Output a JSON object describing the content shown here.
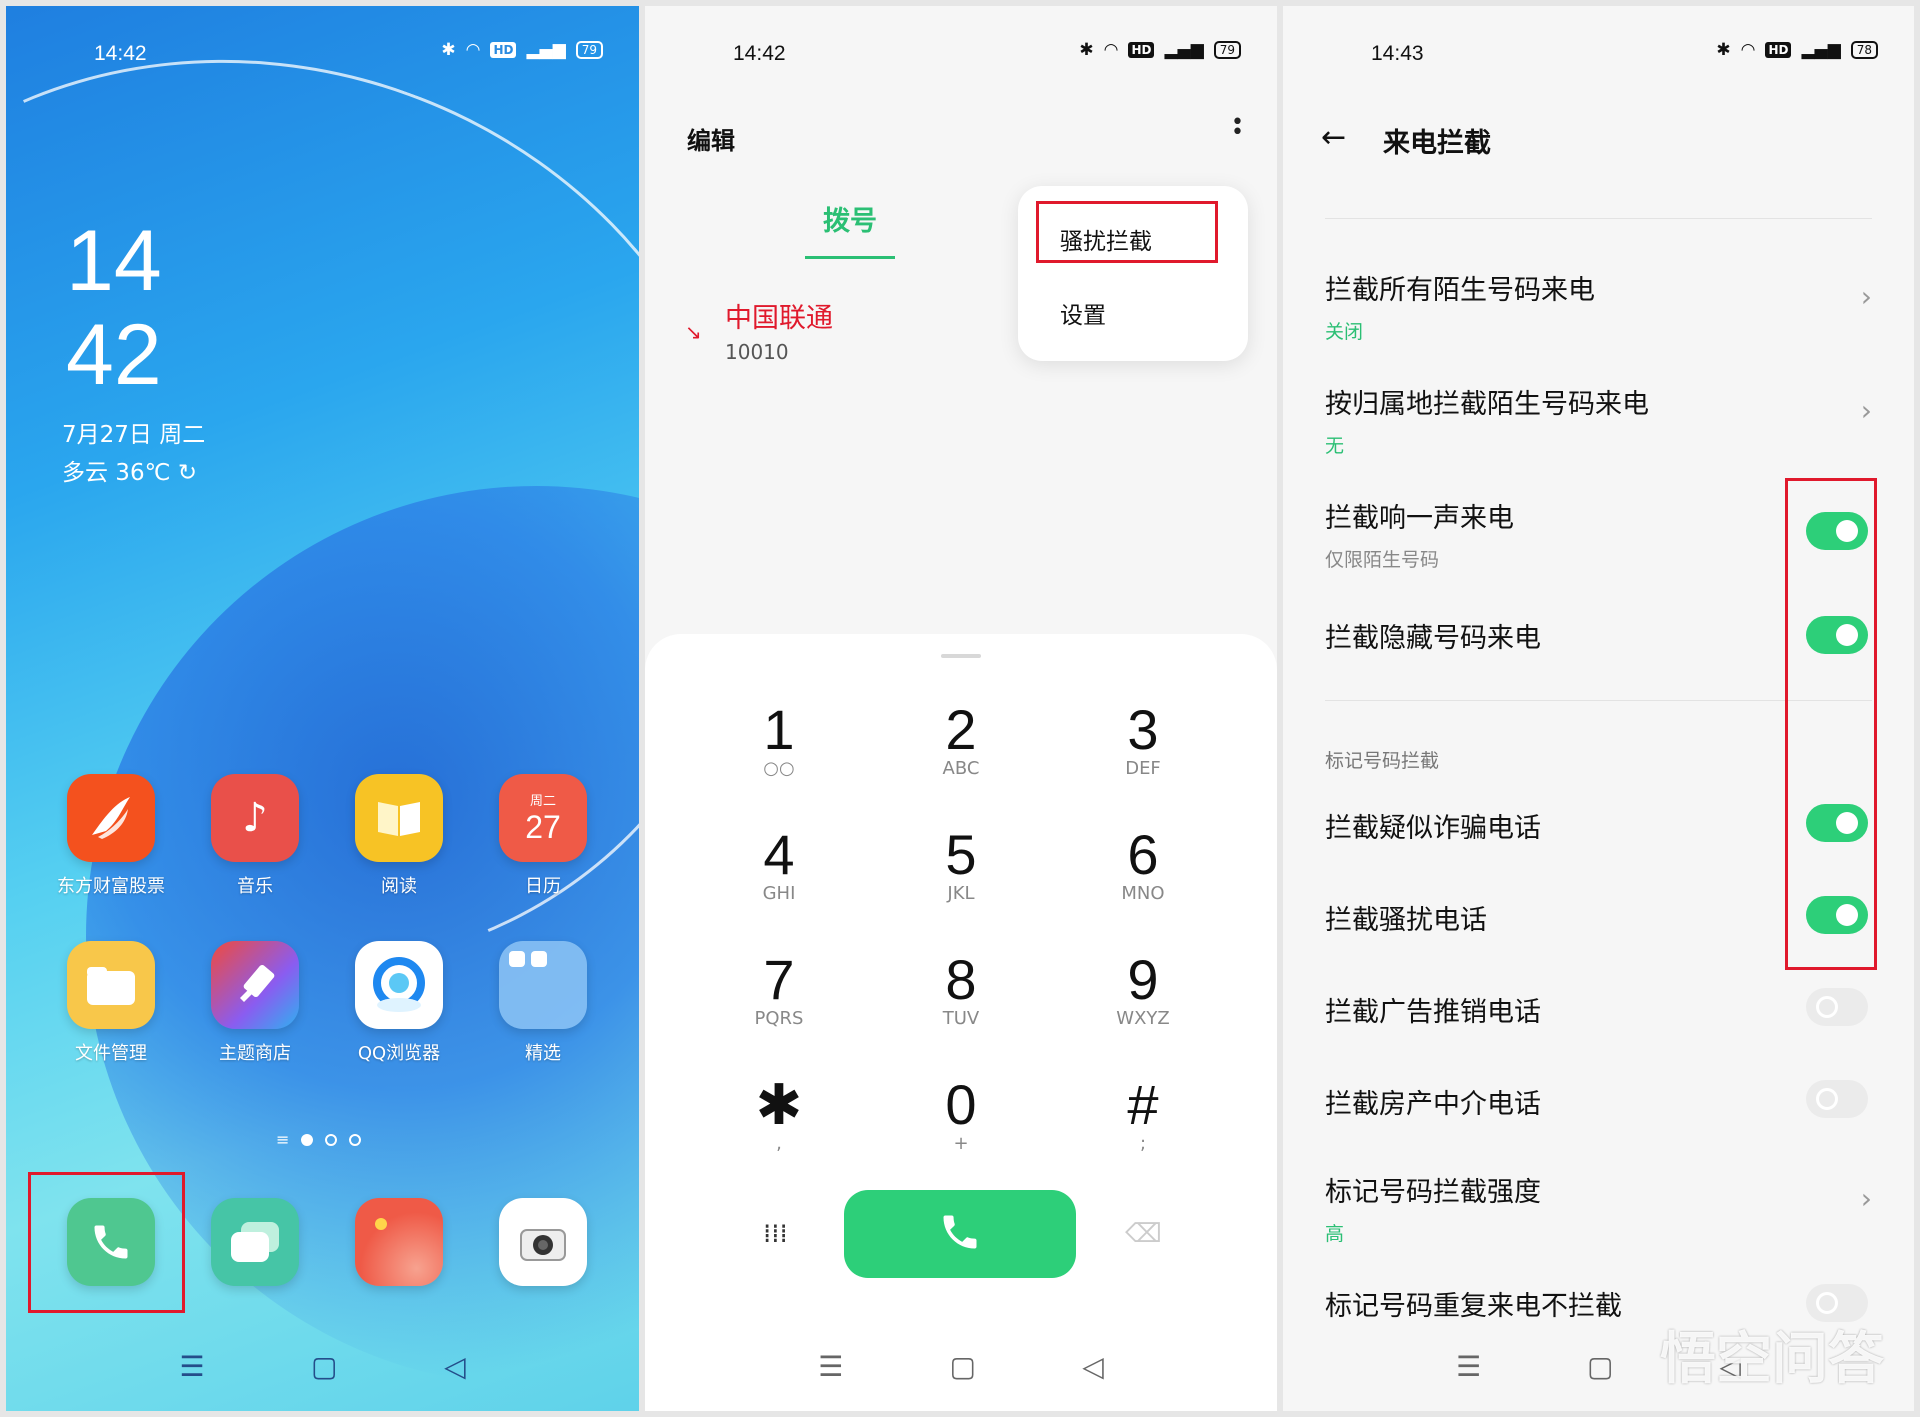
{
  "home": {
    "time": "14:42",
    "battery": "79",
    "clock_hour": "14",
    "clock_minute": "42",
    "date": "7月27日 周二",
    "weather": "多云 36℃",
    "apps": [
      {
        "label": "东方财富股票",
        "icon": "flame-icon",
        "color": "#f4511e"
      },
      {
        "label": "音乐",
        "icon": "music-note-icon",
        "color": "#e9504a"
      },
      {
        "label": "阅读",
        "icon": "book-icon",
        "color": "#f7c325"
      },
      {
        "label": "日历",
        "icon": "calendar-icon",
        "color": "#ef5a47",
        "day_label": "周二",
        "day": "27"
      },
      {
        "label": "文件管理",
        "icon": "folder-icon",
        "color": "#f8c74a"
      },
      {
        "label": "主题商店",
        "icon": "brush-icon",
        "color": "#f0603c"
      },
      {
        "label": "QQ浏览器",
        "icon": "browser-icon",
        "color": "#ffffff"
      },
      {
        "label": "精选",
        "icon": "folder-group-icon",
        "color": "#7fb8f2"
      }
    ],
    "dock": [
      {
        "icon": "phone-icon",
        "color": "#4fc790"
      },
      {
        "icon": "message-icon",
        "color": "#46c5a6"
      },
      {
        "icon": "gallery-icon",
        "color": "#ef5a47"
      },
      {
        "icon": "camera-icon",
        "color": "#ffffff"
      }
    ]
  },
  "dialer": {
    "time": "14:42",
    "battery": "79",
    "edit_label": "编辑",
    "tab_label": "拨号",
    "call_log": {
      "name": "中国联通",
      "number": "10010"
    },
    "menu": {
      "item1": "骚扰拦截",
      "item2": "设置"
    },
    "keys": [
      {
        "digit": "1",
        "sub": "○○"
      },
      {
        "digit": "2",
        "sub": "ABC"
      },
      {
        "digit": "3",
        "sub": "DEF"
      },
      {
        "digit": "4",
        "sub": "GHI"
      },
      {
        "digit": "5",
        "sub": "JKL"
      },
      {
        "digit": "6",
        "sub": "MNO"
      },
      {
        "digit": "7",
        "sub": "PQRS"
      },
      {
        "digit": "8",
        "sub": "TUV"
      },
      {
        "digit": "9",
        "sub": "WXYZ"
      },
      {
        "digit": "✱",
        "sub": ","
      },
      {
        "digit": "0",
        "sub": "+"
      },
      {
        "digit": "#",
        "sub": ";"
      }
    ]
  },
  "settings": {
    "time": "14:43",
    "battery": "78",
    "title": "来电拦截",
    "rows": [
      {
        "title": "拦截所有陌生号码来电",
        "sub": "关闭"
      },
      {
        "title": "按归属地拦截陌生号码来电",
        "sub": "无"
      },
      {
        "title": "拦截响一声来电",
        "sub": "仅限陌生号码",
        "on": true
      },
      {
        "title": "拦截隐藏号码来电",
        "on": true
      }
    ],
    "section_label": "标记号码拦截",
    "rows2": [
      {
        "title": "拦截疑似诈骗电话",
        "on": true
      },
      {
        "title": "拦截骚扰电话",
        "on": true
      },
      {
        "title": "拦截广告推销电话",
        "on": false
      },
      {
        "title": "拦截房产中介电话",
        "on": false
      },
      {
        "title": "标记号码拦截强度",
        "sub": "高"
      },
      {
        "title": "标记号码重复来电不拦截"
      }
    ],
    "watermark": "悟空问答"
  },
  "colors": {
    "accent_green": "#2dcf79",
    "highlight_red": "#e0192c",
    "missed_red": "#e0192c"
  }
}
